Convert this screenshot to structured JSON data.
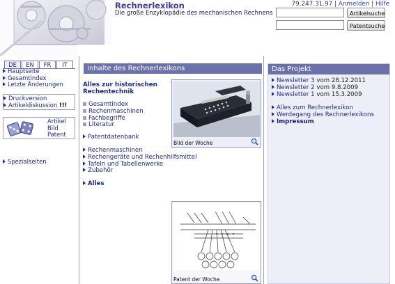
{
  "header": {
    "title": "Rechnerlexikon",
    "subtitle": "Die große Enzyklopädie des mechanischen Rechnens",
    "ip": "79.247.31.97",
    "sep1": "|",
    "login_link": "Anmelden",
    "sep2": "|",
    "help_link": "Hilfe",
    "article_search_value": "",
    "article_search_button": "Artikelsuche",
    "patent_search_value": "",
    "patent_search_button": "Patentsuche"
  },
  "languages": [
    "DE",
    "EN",
    "FR",
    "IT"
  ],
  "sidebar": {
    "nav": [
      "Hauptseite",
      "Gesamtindex",
      "Letzte Änderungen"
    ],
    "tools": [
      "Druckversion",
      "Artikeldiskussion"
    ],
    "tools_flag": "!!!",
    "dice_labels": [
      "Artikel",
      "Bild",
      "Patent"
    ],
    "special": "Spezialseiten"
  },
  "main": {
    "header": "Inhalte des Rechnerlexikons",
    "history_title": "Alles zur historischen Rechentechnik",
    "history_title_line1": "Alles zur historischen",
    "history_title_line2": "Rechentechnik",
    "history_links": [
      "Gesamtindex",
      "Rechenmaschinen",
      "Fachbegriffe",
      "Literatur"
    ],
    "patent_db": "Patentdatenbank",
    "categories": [
      "Rechenmaschinen",
      "Rechengeräte und Rechenhilfsmittel",
      "Tafeln und Tabellenwerke",
      "Zubehör"
    ],
    "all": "Alles",
    "image_caption": "Bild der Woche",
    "patent_caption": "Patent der Woche"
  },
  "project": {
    "header": "Das Projekt",
    "newsletters": [
      {
        "link": "Newsletter 3",
        "date": "vom 28.12.2011"
      },
      {
        "link": "Newsletter 2",
        "date": "vom 9.8.2009"
      },
      {
        "link": "Newsletter 1",
        "date": "vom 15.3.2009"
      }
    ],
    "links": [
      "Alles zum Rechnerlexikon",
      "Werdegang des Rechnerlexikons"
    ],
    "impressum": "Impressum"
  },
  "colors": {
    "accent": "#6b72a9",
    "link": "#1f2a8a",
    "panel_bg": "#eeeef8",
    "border": "#9b9bcc"
  }
}
